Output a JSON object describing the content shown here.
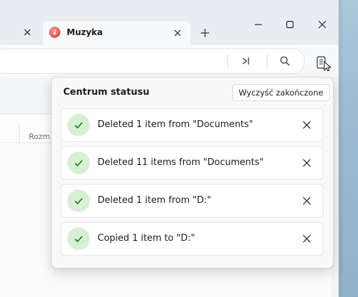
{
  "window": {
    "active_tab_title": "Muzyka"
  },
  "content": {
    "column_size_label": "Rozm"
  },
  "status_center": {
    "title": "Centrum statusu",
    "clear_button_label": "Wyczyść zakończone",
    "items": [
      {
        "text": "Deleted 1 item from \"Documents\"",
        "status": "completed"
      },
      {
        "text": "Deleted 11 items from \"Documents\"",
        "status": "completed"
      },
      {
        "text": "Deleted 1 item from \"D:\"",
        "status": "completed"
      },
      {
        "text": "Copied 1 item to \"D:\"",
        "status": "completed"
      }
    ]
  },
  "colors": {
    "success_bg": "#d7f0d5",
    "success_check": "#107c10",
    "tab_icon": "#e04e4e"
  },
  "icons": {
    "tab": "music-note-icon",
    "status": "checkmark-icon",
    "status_center_button": "status-center-icon"
  }
}
